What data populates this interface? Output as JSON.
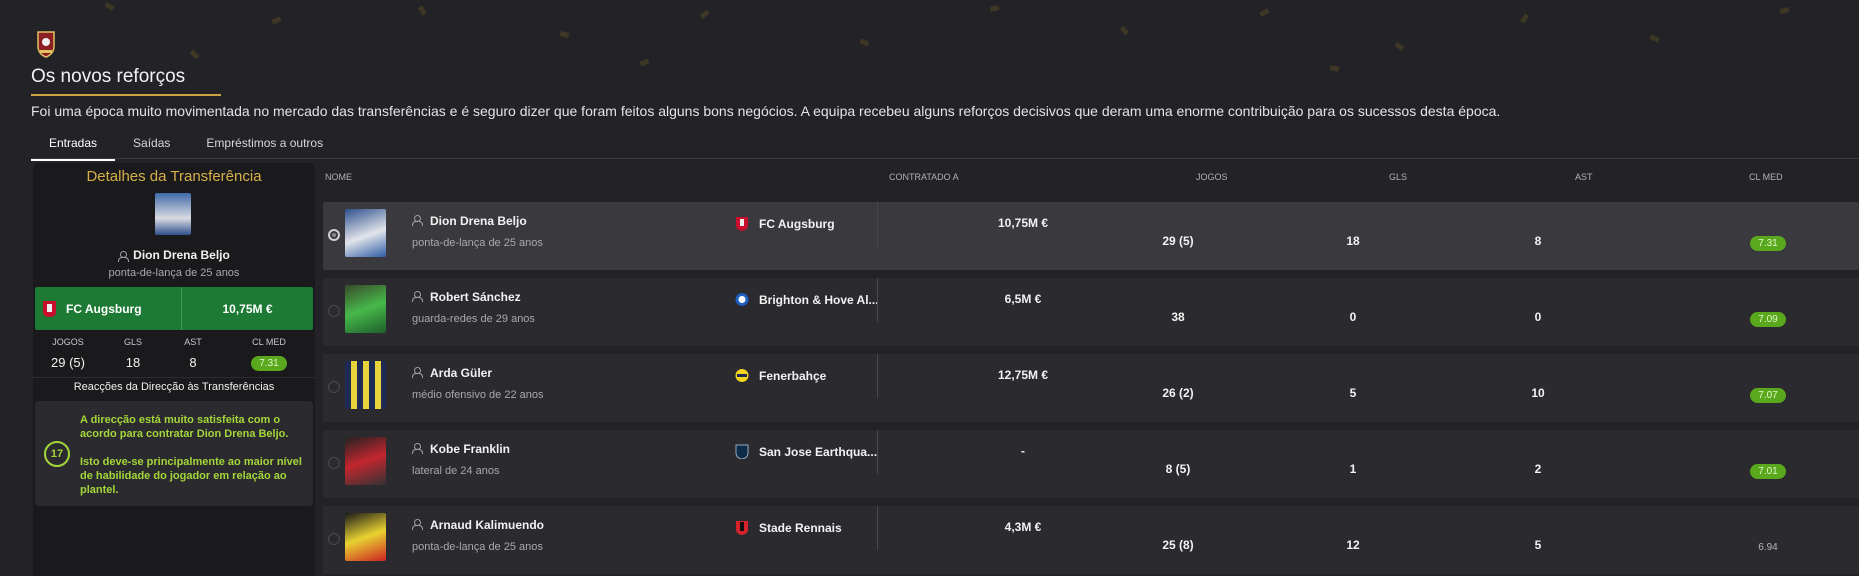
{
  "page": {
    "title": "Os novos reforços",
    "intro": "Foi uma época muito movimentada no mercado das transferências e é seguro dizer que foram feitos alguns bons negócios. A equipa recebeu alguns reforços decisivos que deram uma enorme contribuição para os sucessos desta época."
  },
  "tabs": [
    {
      "label": "Entradas",
      "active": true
    },
    {
      "label": "Saídas",
      "active": false
    },
    {
      "label": "Empréstimos a outros",
      "active": false
    }
  ],
  "detail": {
    "title": "Detalhes da Transferência",
    "player_name": "Dion Drena Beljo",
    "player_desc": "ponta-de-lança de 25 anos",
    "club": "FC Augsburg",
    "fee": "10,75M €",
    "stat_labels": {
      "apps": "JOGOS",
      "gls": "GLS",
      "ast": "AST",
      "rating": "CL MED"
    },
    "stats": {
      "apps": "29 (5)",
      "gls": "18",
      "ast": "8",
      "rating": "7.31"
    },
    "reactions_title": "Reacções da Direcção às Transferências",
    "reaction_number": "17",
    "reaction_line1": "A direcção está muito satisfeita com o acordo para contratar Dion Drena Beljo.",
    "reaction_line2": "Isto deve-se principalmente ao maior nível de habilidade do jogador em relação ao plantel.",
    "reaction_color": "#a4d63a"
  },
  "columns": {
    "name": "NOME",
    "signed_for": "CONTRATADO A",
    "apps": "JOGOS",
    "gls": "GLS",
    "ast": "AST",
    "rating": "CL MED"
  },
  "players": [
    {
      "name": "Dion Drena Beljo",
      "desc": "ponta-de-lança de 25 anos",
      "club": "FC Augsburg",
      "fee": "10,75M €",
      "apps": "29 (5)",
      "gls": "18",
      "ast": "8",
      "rating": "7.31",
      "rating_pill": true,
      "selected": true
    },
    {
      "name": "Robert Sánchez",
      "desc": "guarda-redes de 29 anos",
      "club": "Brighton & Hove Al...",
      "fee": "6,5M €",
      "apps": "38",
      "gls": "0",
      "ast": "0",
      "rating": "7.09",
      "rating_pill": true,
      "selected": false
    },
    {
      "name": "Arda Güler",
      "desc": "médio ofensivo de 22 anos",
      "club": "Fenerbahçe",
      "fee": "12,75M €",
      "apps": "26 (2)",
      "gls": "5",
      "ast": "10",
      "rating": "7.07",
      "rating_pill": true,
      "selected": false
    },
    {
      "name": "Kobe Franklin",
      "desc": "lateral de 24 anos",
      "club": "San Jose Earthqua...",
      "fee": "-",
      "apps": "8 (5)",
      "gls": "1",
      "ast": "2",
      "rating": "7.01",
      "rating_pill": true,
      "selected": false
    },
    {
      "name": "Arnaud Kalimuendo",
      "desc": "ponta-de-lança de 25 anos",
      "club": "Stade Rennais",
      "fee": "4,3M €",
      "apps": "25 (8)",
      "gls": "12",
      "ast": "5",
      "rating": "6.94",
      "rating_pill": false,
      "selected": false
    }
  ],
  "colors": {
    "accent_gold": "#d7b04a",
    "good_rating": "#5aa81e",
    "club_bar": "#1d7a35"
  }
}
